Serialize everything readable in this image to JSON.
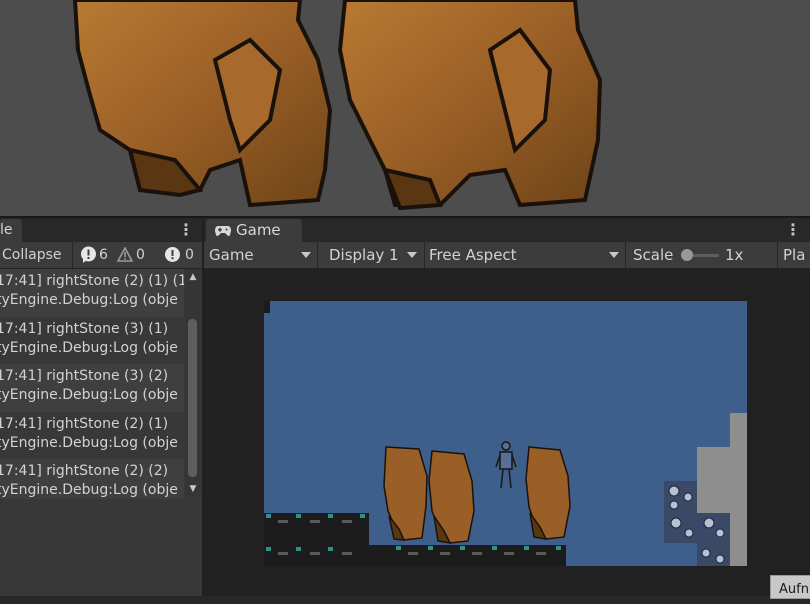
{
  "console": {
    "tab_label": "le",
    "collapse_label": "Collapse",
    "counts": {
      "info": "6",
      "warning": "0",
      "error": "0"
    },
    "logs": [
      {
        "line1": "17:41] rightStone (2) (1) (1",
        "line2": "tyEngine.Debug:Log (obje"
      },
      {
        "line1": "17:41] rightStone (3) (1)",
        "line2": "tyEngine.Debug:Log (obje"
      },
      {
        "line1": "17:41] rightStone (3) (2)",
        "line2": "tyEngine.Debug:Log (obje"
      },
      {
        "line1": "17:41] rightStone (2) (1)",
        "line2": "tyEngine.Debug:Log (obje"
      },
      {
        "line1": "17:41] rightStone (2) (2)",
        "line2": "tyEngine.Debug:Log (obje"
      }
    ]
  },
  "game": {
    "tab_label": "Game",
    "view_mode": "Game",
    "display": "Display 1",
    "aspect": "Free Aspect",
    "scale_label": "Scale",
    "scale_value": "1x",
    "play_label": "Pla",
    "scale_fraction": 0
  },
  "colors": {
    "sky": "#3e5f8c",
    "rock": "#a0642a",
    "ground": "#1c1c1c",
    "teal": "#2f8f8a"
  },
  "footer": {
    "aufn_label": "Aufn"
  }
}
